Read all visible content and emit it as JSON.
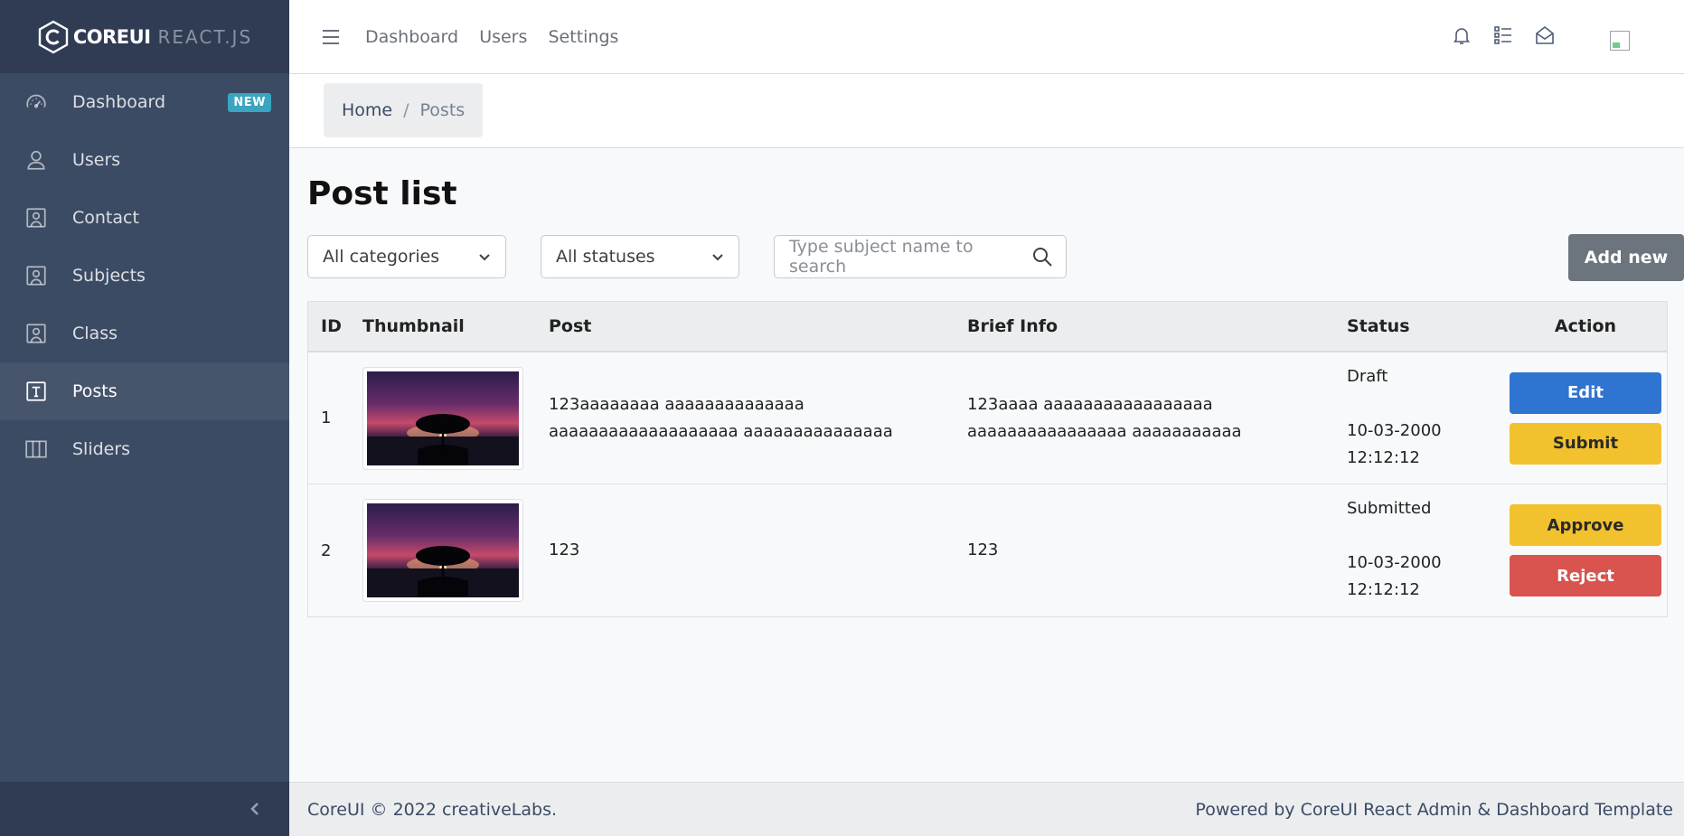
{
  "brand": {
    "core": "COREUI",
    "suffix": "REACT.JS"
  },
  "sidebar": {
    "items": [
      {
        "label": "Dashboard",
        "icon": "speedometer-icon",
        "badge": "NEW"
      },
      {
        "label": "Users",
        "icon": "user-icon"
      },
      {
        "label": "Contact",
        "icon": "contact-icon"
      },
      {
        "label": "Subjects",
        "icon": "contact-icon"
      },
      {
        "label": "Class",
        "icon": "contact-icon"
      },
      {
        "label": "Posts",
        "icon": "text-icon",
        "active": true
      },
      {
        "label": "Sliders",
        "icon": "columns-icon"
      }
    ]
  },
  "header": {
    "nav": [
      "Dashboard",
      "Users",
      "Settings"
    ],
    "icons": [
      "bell-icon",
      "list-icon",
      "envelope-open-icon"
    ]
  },
  "breadcrumb": {
    "home": "Home",
    "separator": "/",
    "current": "Posts"
  },
  "main": {
    "title": "Post list",
    "filters": {
      "category": "All categories",
      "status": "All statuses",
      "search_placeholder": "Type subject name to search"
    },
    "add_button": "Add new"
  },
  "table": {
    "columns": [
      "ID",
      "Thumbnail",
      "Post",
      "Brief Info",
      "Status",
      "Action"
    ],
    "rows": [
      {
        "id": "1",
        "post": "123aaaaaaaa aaaaaaaaaaaaaa aaaaaaaaaaaaaaaaaaa aaaaaaaaaaaaaaa",
        "info": "123aaaa aaaaaaaaaaaaaaaaa aaaaaaaaaaaaaaaa aaaaaaaaaaa",
        "status": "Draft",
        "date": "10-03-2000",
        "time": "12:12:12",
        "actions": [
          "Edit",
          "Submit"
        ]
      },
      {
        "id": "2",
        "post": "123",
        "info": "123",
        "status": "Submitted",
        "date": "10-03-2000",
        "time": "12:12:12",
        "actions": [
          "Approve",
          "Reject"
        ]
      }
    ]
  },
  "footer": {
    "left": "CoreUI © 2022 creativeLabs.",
    "right": "Powered by CoreUI React Admin & Dashboard Template"
  }
}
